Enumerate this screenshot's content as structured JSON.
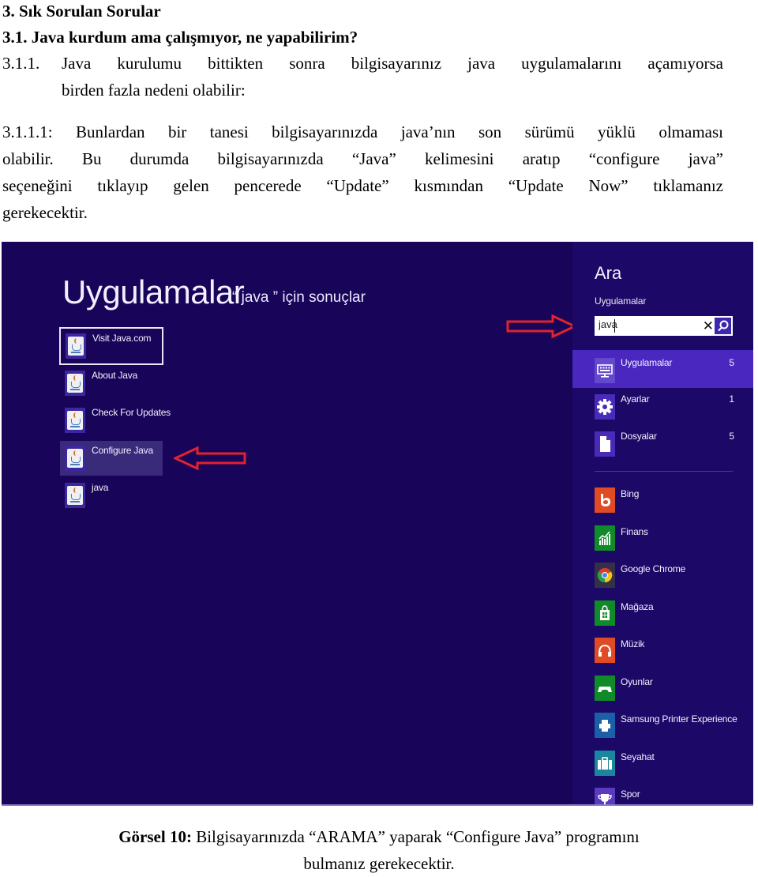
{
  "document": {
    "heading_1": "3.   Sık Sorulan Sorular",
    "heading_2": "3.1. Java kurdum ama çalışmıyor, ne yapabilirim?",
    "para_1": {
      "number": "3.1.1.",
      "line_1": "Java kurulumu bittikten sonra bilgisayarınız java uygulamalarını açamıyorsa",
      "line_2": "birden fazla nedeni olabilir:"
    },
    "para_2": {
      "line_1": "3.1.1.1: Bunlardan bir tanesi bilgisayarınızda java’nın son sürümü yüklü olmaması",
      "line_2": "olabilir. Bu durumda bilgisayarınızda “Java”  kelimesini aratıp “configure java”",
      "line_3": "seçeneğini tıklayıp gelen pencerede “Update” kısmından “Update Now” tıklamanız",
      "line_4": "gerekecektir."
    },
    "caption": {
      "label": "Görsel 10:",
      "text_1": " Bilgisayarınızda “ARAMA” yaparak “Configure Java” programını",
      "text_2": "bulmanız gerekecektir."
    }
  },
  "screenshot": {
    "background_color": "#180458",
    "results_title": "Uygulamalar",
    "results_subtitle": "“ java ” için sonuçlar",
    "apps": [
      {
        "label": "Visit Java.com",
        "icon": "java-icon",
        "state": "selected"
      },
      {
        "label": "About Java",
        "icon": "java-icon",
        "state": "normal"
      },
      {
        "label": "Check For Updates",
        "icon": "java-icon",
        "state": "normal"
      },
      {
        "label": "Configure Java",
        "icon": "java-icon",
        "state": "highlighted"
      },
      {
        "label": "java",
        "icon": "java-icon",
        "state": "normal"
      }
    ],
    "annotation_color": "#e0232e",
    "search_pane": {
      "title": "Ara",
      "scope": "Uygulamalar",
      "query": "java",
      "clear_label": "✕",
      "categories": [
        {
          "label": "Uygulamalar",
          "count": "5",
          "icon": "keyboard-monitor-icon",
          "active": true
        },
        {
          "label": "Ayarlar",
          "count": "1",
          "icon": "gear-icon",
          "active": false
        },
        {
          "label": "Dosyalar",
          "count": "5",
          "icon": "file-icon",
          "active": false
        }
      ],
      "results": [
        {
          "label": "Bing",
          "icon": "bing-icon",
          "color": "#e04a24"
        },
        {
          "label": "Finans",
          "icon": "finance-chart-icon",
          "color": "#118a2a"
        },
        {
          "label": "Google Chrome",
          "icon": "chrome-icon",
          "color": "#34304a"
        },
        {
          "label": "Mağaza",
          "icon": "store-bag-icon",
          "color": "#118a2a"
        },
        {
          "label": "Müzik",
          "icon": "headphones-icon",
          "color": "#e04a24"
        },
        {
          "label": "Oyunlar",
          "icon": "gamepad-icon",
          "color": "#118a2a"
        },
        {
          "label": "Samsung Printer Experience",
          "icon": "printer-icon",
          "color": "#1b5fa8"
        },
        {
          "label": "Seyahat",
          "icon": "suitcase-icon",
          "color": "#1a86a0"
        },
        {
          "label": "Spor",
          "icon": "trophy-icon",
          "color": "#5a3abf"
        }
      ]
    }
  }
}
